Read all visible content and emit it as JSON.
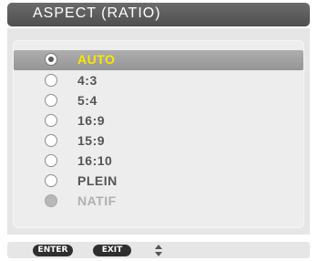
{
  "menu": {
    "title": "ASPECT (RATIO)",
    "options": [
      {
        "label": "AUTO",
        "state": "selected"
      },
      {
        "label": "4:3",
        "state": "normal"
      },
      {
        "label": "5:4",
        "state": "normal"
      },
      {
        "label": "16:9",
        "state": "normal"
      },
      {
        "label": "15:9",
        "state": "normal"
      },
      {
        "label": "16:10",
        "state": "normal"
      },
      {
        "label": "PLEIN",
        "state": "normal"
      },
      {
        "label": "NATIF",
        "state": "disabled"
      }
    ]
  },
  "footer": {
    "enter_label": "ENTER",
    "exit_label": "EXIT",
    "nav_icon": "up-down-arrows-icon"
  },
  "colors": {
    "selected_text": "#ffe600",
    "normal_text": "#555555",
    "disabled_text": "#b0b0b0",
    "title_bar": "#5c5c5c"
  }
}
